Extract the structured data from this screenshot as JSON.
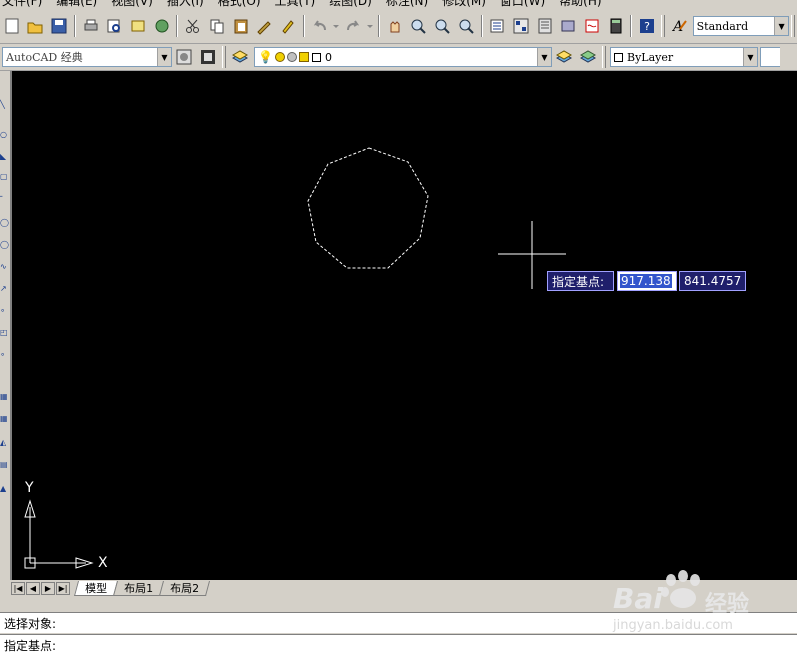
{
  "menu": {
    "items": [
      "文件(F)",
      "编辑(E)",
      "视图(V)",
      "插入(I)",
      "格式(O)",
      "工具(T)",
      "绘图(D)",
      "标注(N)",
      "修改(M)",
      "窗口(W)",
      "帮助(H)"
    ]
  },
  "toolbar": {
    "text_style": "Standard"
  },
  "toolbar2": {
    "workspace": "AutoCAD 经典",
    "layer": "0",
    "color": "ByLayer"
  },
  "canvas": {
    "dynamic_prompt": "指定基点:",
    "x_value": "917.138",
    "y_value": "841.4757",
    "ucs_x_label": "X",
    "ucs_y_label": "Y"
  },
  "tabs": [
    "模型",
    "布局1",
    "布局2"
  ],
  "command": {
    "line1": "选择对象:",
    "line2": "指定基点:"
  },
  "colors": {
    "canvas_bg": "#000000",
    "dyn_bg": "#1f1f6b",
    "dyn_border": "#a0a0ff",
    "selected_field": "#3355cc"
  },
  "watermark": {
    "brand": "Bai",
    "brand_cn": "经验",
    "url": "jingyan.baidu.com"
  }
}
